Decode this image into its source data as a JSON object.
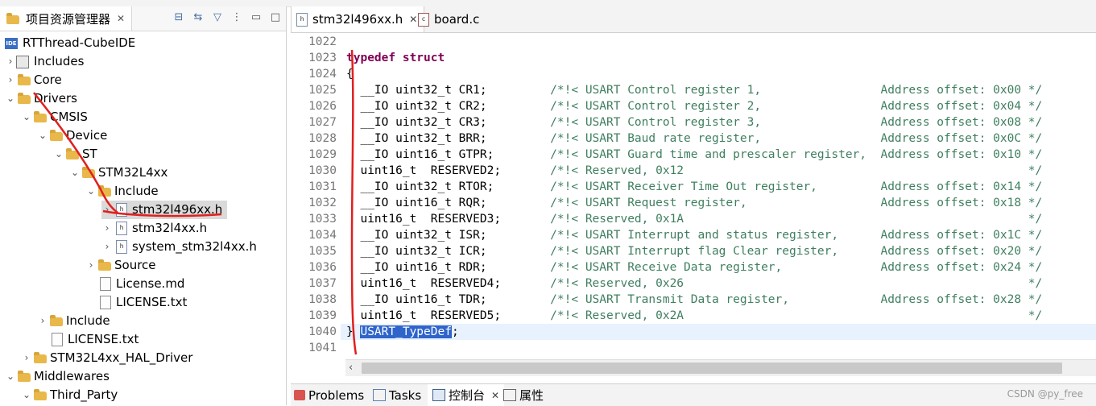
{
  "explorer": {
    "tab_label": "项目资源管理器",
    "close_glyph": "✕",
    "items": [
      {
        "label": "RTThread-CubeIDE",
        "icon": "project-icon"
      },
      {
        "label": "Includes",
        "icon": "includes-icon"
      },
      {
        "label": "Core",
        "icon": "folder-icon"
      },
      {
        "label": "Drivers",
        "icon": "folder-icon"
      },
      {
        "label": "CMSIS",
        "icon": "folder-icon"
      },
      {
        "label": "Device",
        "icon": "folder-icon"
      },
      {
        "label": "ST",
        "icon": "folder-icon"
      },
      {
        "label": "STM32L4xx",
        "icon": "folder-icon"
      },
      {
        "label": "Include",
        "icon": "folder-icon"
      },
      {
        "label": "stm32l496xx.h",
        "icon": "header-file-icon"
      },
      {
        "label": "stm32l4xx.h",
        "icon": "header-file-icon"
      },
      {
        "label": "system_stm32l4xx.h",
        "icon": "header-file-icon"
      },
      {
        "label": "Source",
        "icon": "folder-icon"
      },
      {
        "label": "License.md",
        "icon": "text-file-icon"
      },
      {
        "label": "LICENSE.txt",
        "icon": "text-file-icon"
      },
      {
        "label": "Include",
        "icon": "folder-icon"
      },
      {
        "label": "LICENSE.txt",
        "icon": "text-file-icon"
      },
      {
        "label": "STM32L4xx_HAL_Driver",
        "icon": "folder-icon"
      },
      {
        "label": "Middlewares",
        "icon": "folder-icon"
      },
      {
        "label": "Third_Party",
        "icon": "folder-icon"
      }
    ]
  },
  "editor": {
    "tabs": [
      {
        "label": "stm32l496xx.h",
        "close": "✕"
      },
      {
        "label": "board.c"
      }
    ],
    "lines": [
      {
        "n": "1022",
        "t": ""
      },
      {
        "n": "1023",
        "t": "typedef struct"
      },
      {
        "n": "1024",
        "t": "{"
      },
      {
        "n": "1025",
        "t": "  __IO uint32_t CR1;         /*!< USART Control register 1,                 Address offset: 0x00 */"
      },
      {
        "n": "1026",
        "t": "  __IO uint32_t CR2;         /*!< USART Control register 2,                 Address offset: 0x04 */"
      },
      {
        "n": "1027",
        "t": "  __IO uint32_t CR3;         /*!< USART Control register 3,                 Address offset: 0x08 */"
      },
      {
        "n": "1028",
        "t": "  __IO uint32_t BRR;         /*!< USART Baud rate register,                 Address offset: 0x0C */"
      },
      {
        "n": "1029",
        "t": "  __IO uint16_t GTPR;        /*!< USART Guard time and prescaler register,  Address offset: 0x10 */"
      },
      {
        "n": "1030",
        "t": "  uint16_t  RESERVED2;       /*!< Reserved, 0x12                                                 */"
      },
      {
        "n": "1031",
        "t": "  __IO uint32_t RTOR;        /*!< USART Receiver Time Out register,         Address offset: 0x14 */"
      },
      {
        "n": "1032",
        "t": "  __IO uint16_t RQR;         /*!< USART Request register,                   Address offset: 0x18 */"
      },
      {
        "n": "1033",
        "t": "  uint16_t  RESERVED3;       /*!< Reserved, 0x1A                                                 */"
      },
      {
        "n": "1034",
        "t": "  __IO uint32_t ISR;         /*!< USART Interrupt and status register,      Address offset: 0x1C */"
      },
      {
        "n": "1035",
        "t": "  __IO uint32_t ICR;         /*!< USART Interrupt flag Clear register,      Address offset: 0x20 */"
      },
      {
        "n": "1036",
        "t": "  __IO uint16_t RDR;         /*!< USART Receive Data register,              Address offset: 0x24 */"
      },
      {
        "n": "1037",
        "t": "  uint16_t  RESERVED4;       /*!< Reserved, 0x26                                                 */"
      },
      {
        "n": "1038",
        "t": "  __IO uint16_t TDR;         /*!< USART Transmit Data register,             Address offset: 0x28 */"
      },
      {
        "n": "1039",
        "t": "  uint16_t  RESERVED5;       /*!< Reserved, 0x2A                                                 */"
      },
      {
        "n": "1040",
        "t": "} USART_TypeDef;"
      },
      {
        "n": "1041",
        "t": ""
      }
    ]
  },
  "bottom": {
    "tabs": [
      {
        "label": "Problems"
      },
      {
        "label": "Tasks"
      },
      {
        "label": "控制台",
        "close": "✕"
      },
      {
        "label": "属性"
      }
    ]
  },
  "watermark": "CSDN @py_free",
  "colors": {
    "keyword": "#7f0055",
    "comment": "#3f7f5f",
    "selection": "#2f65ca",
    "annotation": "#e0201e"
  }
}
